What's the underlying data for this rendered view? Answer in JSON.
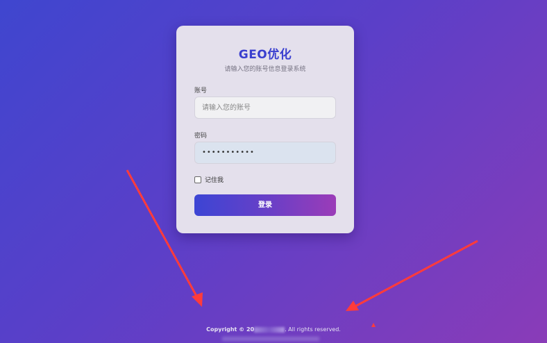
{
  "login_card": {
    "title": "GEO优化",
    "subtitle": "请输入您的账号信息登录系统",
    "account_label": "账号",
    "account_placeholder": "请输入您的账号",
    "account_value": "",
    "password_label": "密码",
    "password_value": "•••••••••••",
    "remember_label": "记住我",
    "remember_checked": false,
    "login_button_label": "登录"
  },
  "footer": {
    "copyright_prefix": "Copyright © 20",
    "copyright_suffix": ". All rights reserved."
  },
  "colors": {
    "background_start": "#3f46cf",
    "background_end": "#8a3cb8",
    "title": "#3a3fcf",
    "annotation_arrow": "#ff3b3b"
  }
}
